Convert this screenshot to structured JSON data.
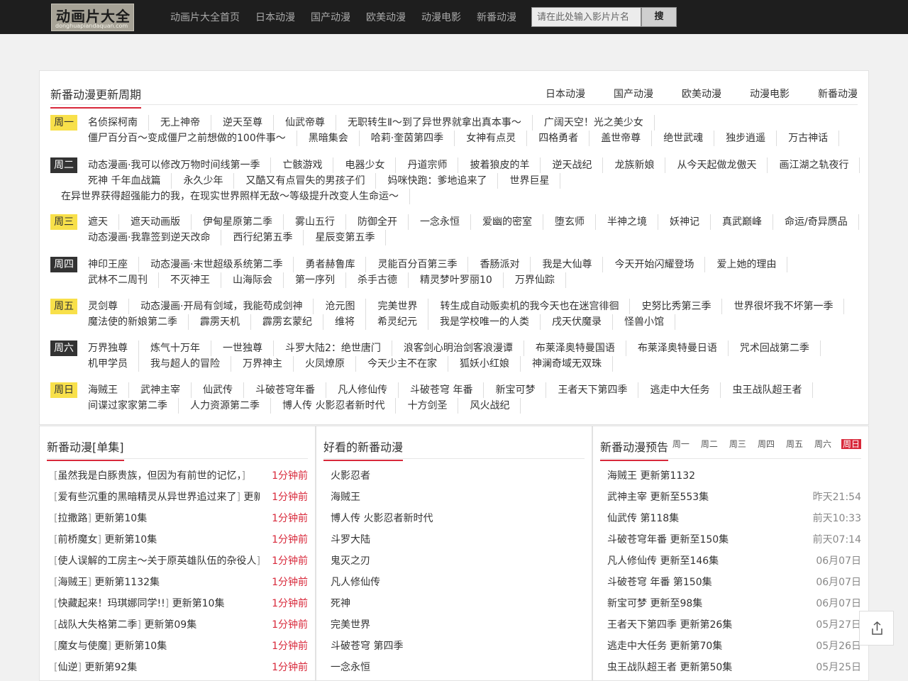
{
  "header": {
    "logo_main": "动画片大全",
    "logo_sub": "donghuapiandaquan.com",
    "nav": [
      "动画片大全首页",
      "日本动漫",
      "国产动漫",
      "欧美动漫",
      "动漫电影",
      "新番动漫"
    ],
    "search_placeholder": "请在此处输入影片片名",
    "search_button": "搜"
  },
  "schedule": {
    "title": "新番动漫更新周期",
    "tabs": [
      "日本动漫",
      "国产动漫",
      "欧美动漫",
      "动漫电影",
      "新番动漫"
    ],
    "days": [
      {
        "day": "周一",
        "style": "yellow",
        "lines": [
          [
            "名侦探柯南",
            "无上神帝",
            "逆天至尊",
            "仙武帝尊",
            "无职转生Ⅱ～到了异世界就拿出真本事～",
            "广阔天空！光之美少女"
          ],
          [
            "僵尸百分百～变成僵尸之前想做的100件事～",
            "黑暗集会",
            "哈莉·奎茵第四季",
            "女神有点灵",
            "四格勇者",
            "盖世帝尊",
            "绝世武魂",
            "独步逍遥",
            "万古神话"
          ]
        ]
      },
      {
        "day": "周二",
        "style": "dark",
        "lines": [
          [
            "动态漫画·我可以修改万物时间线第一季",
            "亡骸游戏",
            "电器少女",
            "丹道宗师",
            "披着狼皮的羊",
            "逆天战纪",
            "龙族新娘",
            "从今天起做龙傲天",
            "画江湖之轨夜行"
          ],
          [
            "死神 千年血战篇",
            "永久少年",
            "又酷又有点冒失的男孩子们",
            "妈咪快跑：爹地追来了",
            "世界巨星"
          ],
          [
            "在异世界获得超强能力的我，在现实世界照样无敌～等级提升改变人生命运～"
          ]
        ]
      },
      {
        "day": "周三",
        "style": "yellow",
        "lines": [
          [
            "遮天",
            "遮天动画版",
            "伊甸星原第二季",
            "雾山五行",
            "防御全开",
            "一念永恒",
            "爱幽的密室",
            "堕玄师",
            "半神之境",
            "妖神记",
            "真武巅峰",
            "命运/奇异赝品"
          ],
          [
            "动态漫画·我靠签到逆天改命",
            "西行纪第五季",
            "星辰变第五季"
          ]
        ]
      },
      {
        "day": "周四",
        "style": "dark",
        "lines": [
          [
            "神印王座",
            "动态漫画·末世超级系统第二季",
            "勇者赫鲁库",
            "灵能百分百第三季",
            "香肠派对",
            "我是大仙尊",
            "今天开始闪耀登场",
            "爱上她的理由"
          ],
          [
            "武林不二周刊",
            "不灭神王",
            "山海际会",
            "第一序列",
            "杀手古德",
            "精灵梦叶罗丽10",
            "万界仙踪"
          ]
        ]
      },
      {
        "day": "周五",
        "style": "yellow",
        "lines": [
          [
            "灵剑尊",
            "动态漫画·开局有剑域，我能苟成剑神",
            "沧元图",
            "完美世界",
            "转生成自动贩卖机的我今天也在迷宫徘徊",
            "史努比秀第三季",
            "世界很坏我不坏第一季"
          ],
          [
            "魔法使的新娘第二季",
            "霹雳天机",
            "霹雳玄蒙纪",
            "维将",
            "希灵纪元",
            "我是学校唯一的人类",
            "戌天伏魔录",
            "怪兽小馆"
          ]
        ]
      },
      {
        "day": "周六",
        "style": "dark",
        "lines": [
          [
            "万界独尊",
            "炼气十万年",
            "一世独尊",
            "斗罗大陆2：绝世唐门",
            "浪客剑心明治剑客浪漫谭",
            "布莱泽奥特曼国语",
            "布莱泽奥特曼日语",
            "咒术回战第二季"
          ],
          [
            "机甲学员",
            "我与超人的冒险",
            "万界神主",
            "火凤燎原",
            "今天少主不在家",
            "狐妖小红娘",
            "神澜奇域无双珠"
          ]
        ]
      },
      {
        "day": "周日",
        "style": "yellow",
        "lines": [
          [
            "海贼王",
            "武神主宰",
            "仙武传",
            "斗破苍穹年番",
            "凡人修仙传",
            "斗破苍穹 年番",
            "新宝可梦",
            "王者天下第四季",
            "逃走中大任务",
            "虫王战队超王者"
          ],
          [
            "间谍过家家第二季",
            "人力资源第二季",
            "博人传 火影忍者新时代",
            "十方剑圣",
            "风火战纪"
          ]
        ]
      }
    ]
  },
  "episodes": {
    "title": "新番动漫[单集]",
    "items": [
      {
        "name": "虽然我是白豚贵族，但因为有前世的记忆，",
        "ep": "",
        "time": "1分钟前"
      },
      {
        "name": "爱有些沉重的黑暗精灵从异世界追过来了",
        "ep": "更新",
        "time": "1分钟前"
      },
      {
        "name": "拉撒路",
        "ep": "更新第10集",
        "time": "1分钟前"
      },
      {
        "name": "前桥魔女",
        "ep": "更新第10集",
        "time": "1分钟前"
      },
      {
        "name": "使人误解的工房主～关于原英雄队伍的杂役人",
        "ep": "",
        "time": "1分钟前"
      },
      {
        "name": "海贼王",
        "ep": "更新第1132集",
        "time": "1分钟前"
      },
      {
        "name": "快藏起来！玛琪娜同学!!",
        "ep": "更新第10集",
        "time": "1分钟前"
      },
      {
        "name": "战队大失格第二季",
        "ep": "更新第09集",
        "time": "1分钟前"
      },
      {
        "name": "魔女与使魔",
        "ep": "更新第10集",
        "time": "1分钟前"
      },
      {
        "name": "仙逆",
        "ep": "更新第92集",
        "time": "1分钟前"
      }
    ]
  },
  "popular": {
    "title": "好看的新番动漫",
    "items": [
      "火影忍者",
      "海贼王",
      "博人传 火影忍者新时代",
      "斗罗大陆",
      "鬼灭之刃",
      "凡人修仙传",
      "死神",
      "完美世界",
      "斗破苍穹 第四季",
      "一念永恒"
    ]
  },
  "preview": {
    "title": "新番动漫预告",
    "days": [
      "周一",
      "周二",
      "周三",
      "周四",
      "周五",
      "周六",
      "周日"
    ],
    "active_day": "周日",
    "items": [
      {
        "text": "海贼王 更新第1132",
        "date": ""
      },
      {
        "text": "武神主宰 更新至553集",
        "date": "昨天21:54"
      },
      {
        "text": "仙武传 第118集",
        "date": "前天10:33"
      },
      {
        "text": "斗破苍穹年番 更新至150集",
        "date": "前天07:14"
      },
      {
        "text": "凡人修仙传 更新至146集",
        "date": "06月07日"
      },
      {
        "text": "斗破苍穹 年番 第150集",
        "date": "06月07日"
      },
      {
        "text": "新宝可梦 更新至98集",
        "date": "06月07日"
      },
      {
        "text": "王者天下第四季 更新第26集",
        "date": "05月27日"
      },
      {
        "text": "逃走中大任务 更新第70集",
        "date": "05月26日"
      },
      {
        "text": "虫王战队超王者 更新第50集",
        "date": "05月25日"
      }
    ]
  },
  "colors": {
    "accent": "#d8283a",
    "badge_yellow": "#f8e04a",
    "badge_dark": "#333333",
    "topbar": "#1e1e1e"
  },
  "icons": {
    "share": "share-icon"
  }
}
